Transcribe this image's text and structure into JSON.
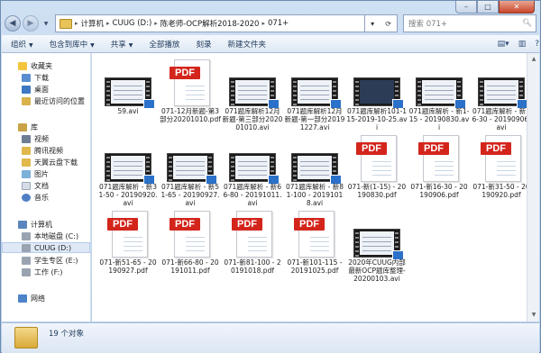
{
  "window": {
    "min_glyph": "–",
    "max_glyph": "□",
    "close_glyph": "✕"
  },
  "address": {
    "segments": [
      "计算机",
      "CUUG (D:)",
      "陈老师-OCP解析2018-2020",
      "071+"
    ],
    "placeholder": "搜索 071+"
  },
  "toolbar": {
    "items": [
      "组织",
      "包含到库中",
      "共享",
      "全部播放",
      "刻录",
      "新建文件夹"
    ]
  },
  "sidebar": {
    "favorites": "收藏夹",
    "fav_items": [
      "下载",
      "桌面",
      "最近访问的位置"
    ],
    "libraries": "库",
    "lib_items": [
      "视频",
      "腾讯视频",
      "天翼云盘下载",
      "图片",
      "文档",
      "音乐"
    ],
    "computer": "计算机",
    "drives": [
      "本地磁盘 (C:)",
      "CUUG (D:)",
      "学生专区 (E:)",
      "工作 (F:)"
    ],
    "network": "网络"
  },
  "files": [
    {
      "name": "59.avi",
      "type": "avi"
    },
    {
      "name": "071-12月新题-第3部分20201010.pdf",
      "type": "pdf"
    },
    {
      "name": "071题库解析12月新题-第三部分202001010.avi",
      "type": "avi"
    },
    {
      "name": "071题库解析12月新题-第一部分20191227.avi",
      "type": "avi"
    },
    {
      "name": "071题库解析101-115-2019-10-25.avi",
      "type": "avi",
      "dark": true
    },
    {
      "name": "071题库解析 - 新1-15 - 20190830.avi",
      "type": "avi"
    },
    {
      "name": "071题库解析 - 新16-30 - 20190906.avi",
      "type": "avi"
    },
    {
      "name": "071题库解析 - 新31-50 - 20190920.avi",
      "type": "avi"
    },
    {
      "name": "071题库解析 - 新51-65 - 20190927.avi",
      "type": "avi"
    },
    {
      "name": "071题库解析 - 新66-80 - 20191011.avi",
      "type": "avi"
    },
    {
      "name": "071题库解析 - 新81-100 - 20191018.avi",
      "type": "avi"
    },
    {
      "name": "071-新(1-15) - 20190830.pdf",
      "type": "pdf"
    },
    {
      "name": "071-新16-30 - 20190906.pdf",
      "type": "pdf"
    },
    {
      "name": "071-新31-50 - 20190920.pdf",
      "type": "pdf"
    },
    {
      "name": "071-新51-65 - 20190927.pdf",
      "type": "pdf"
    },
    {
      "name": "071-新66-80 - 20191011.pdf",
      "type": "pdf"
    },
    {
      "name": "071-新81-100 - 20191018.pdf",
      "type": "pdf"
    },
    {
      "name": "071-新101-115 - 20191025.pdf",
      "type": "pdf"
    },
    {
      "name": "2020年CUUG内部最新OCP题库整理-20200103.avi",
      "type": "avi"
    }
  ],
  "pdf_badge": "PDF",
  "status": {
    "count": "19 个对象"
  }
}
